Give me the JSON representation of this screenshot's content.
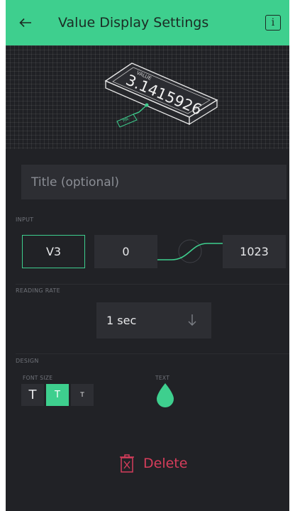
{
  "header": {
    "title": "Value Display Settings",
    "info_glyph": "i",
    "background": "#3ecf8e"
  },
  "preview": {
    "widget_label": "VALUE",
    "widget_value": "3.1415926",
    "pin_tag": "PIN"
  },
  "title_field": {
    "value": "",
    "placeholder": "Title (optional)"
  },
  "input": {
    "section_label": "INPUT",
    "pin": "V3",
    "min": "0",
    "max": "1023"
  },
  "reading_rate": {
    "section_label": "READING RATE",
    "value": "1 sec",
    "arrow_icon": "arrow-down-icon"
  },
  "design": {
    "section_label": "DESIGN",
    "font_size_label": "FONT SIZE",
    "font_size_options": [
      "T",
      "T",
      "T"
    ],
    "font_size_selected_index": 1,
    "text_label": "TEXT",
    "text_color": "#3ecf8e"
  },
  "actions": {
    "delete_label": "Delete",
    "delete_color": "#d63d5b"
  }
}
